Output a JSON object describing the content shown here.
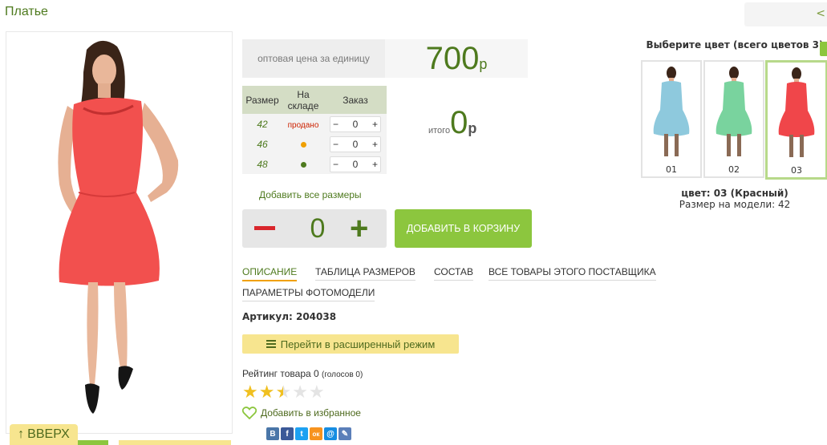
{
  "page": {
    "title": "Платье",
    "nav_arrow": "<"
  },
  "price": {
    "label": "оптовая цена за единицу",
    "value": "700",
    "currency": "р"
  },
  "sizes": {
    "headers": [
      "Размер",
      "На складе",
      "Заказ"
    ],
    "rows": [
      {
        "size": "42",
        "stock": "продано",
        "qty": "0"
      },
      {
        "size": "46",
        "stock": "",
        "qty": "0"
      },
      {
        "size": "48",
        "stock": "",
        "qty": "0"
      }
    ],
    "stock_colors": {
      "limited": "#f0a000",
      "available": "#4e7a1e"
    }
  },
  "total": {
    "label": "итого",
    "value": "0",
    "currency": "р"
  },
  "add_all_sizes": "Добавить все размеры",
  "quantity": "0",
  "cart_button": "ДОБАВИТЬ В КОРЗИНУ",
  "tabs": [
    "ОПИСАНИЕ",
    "ТАБЛИЦА РАЗМЕРОВ",
    "СОСТАВ",
    "ВСЕ ТОВАРЫ ЭТОГО ПОСТАВЩИКА",
    "ПАРАМЕТРЫ ФОТОМОДЕЛИ"
  ],
  "article": "Артикул: 204038",
  "advanced_mode": "Перейти в расширенный режим",
  "rating": {
    "text": "Рейтинг товара 0",
    "votes": "(голосов 0)",
    "stars_filled": 2.5,
    "stars_total": 5
  },
  "favorite": "Добавить в избранное",
  "up_button": "ВВЕРХ",
  "colors": {
    "title": "Выберите цвет (всего цветов 3)",
    "options": [
      {
        "label": "01",
        "color": "#8ec9dd"
      },
      {
        "label": "02",
        "color": "#79d39e"
      },
      {
        "label": "03",
        "color": "#f0464a"
      }
    ],
    "selected": "цвет: 03 (Красный)",
    "model_size": "Размер на модели: 42"
  },
  "social": [
    "В",
    "f",
    "t",
    "ок",
    "@",
    "✎"
  ],
  "accent": "#8cc63e"
}
